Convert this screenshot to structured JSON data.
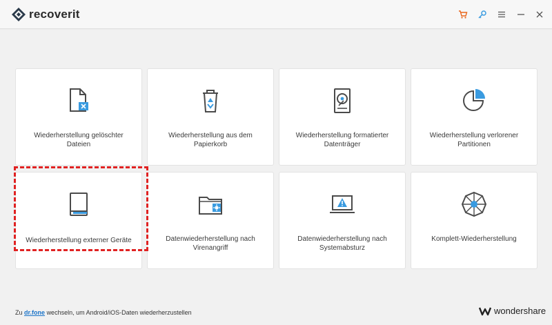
{
  "header": {
    "app_title": "recoverit",
    "icons": [
      "cart-icon",
      "key-icon",
      "menu-icon",
      "minimize-icon",
      "close-icon"
    ]
  },
  "cards": [
    {
      "label": "Wiederherstellung gelöschter Dateien",
      "icon": "deleted-file-icon"
    },
    {
      "label": "Wiederherstellung aus dem Papierkorb",
      "icon": "recycle-bin-icon"
    },
    {
      "label": "Wiederherstellung formatierter Datenträger",
      "icon": "hard-drive-icon"
    },
    {
      "label": "Wiederherstellung verlorener Partitionen",
      "icon": "partition-pie-icon"
    },
    {
      "label": "Wiederherstellung externer Geräte",
      "icon": "external-device-icon"
    },
    {
      "label": "Datenwiederherstellung nach Virenangriff",
      "icon": "virus-folder-icon"
    },
    {
      "label": "Datenwiederherstellung nach Systemabsturz",
      "icon": "crashed-computer-icon"
    },
    {
      "label": "Komplett-Wiederherstellung",
      "icon": "all-round-icon"
    }
  ],
  "footer": {
    "prefix": "Zu",
    "link": "dr.fone",
    "suffix": "wechseln, um Android/iOS-Daten wiederherzustellen",
    "brand": "wondershare"
  },
  "colors": {
    "accent": "#3a9be0",
    "icon_dark": "#4a4a4a",
    "highlight": "#e02222",
    "cart": "#e8661c"
  }
}
